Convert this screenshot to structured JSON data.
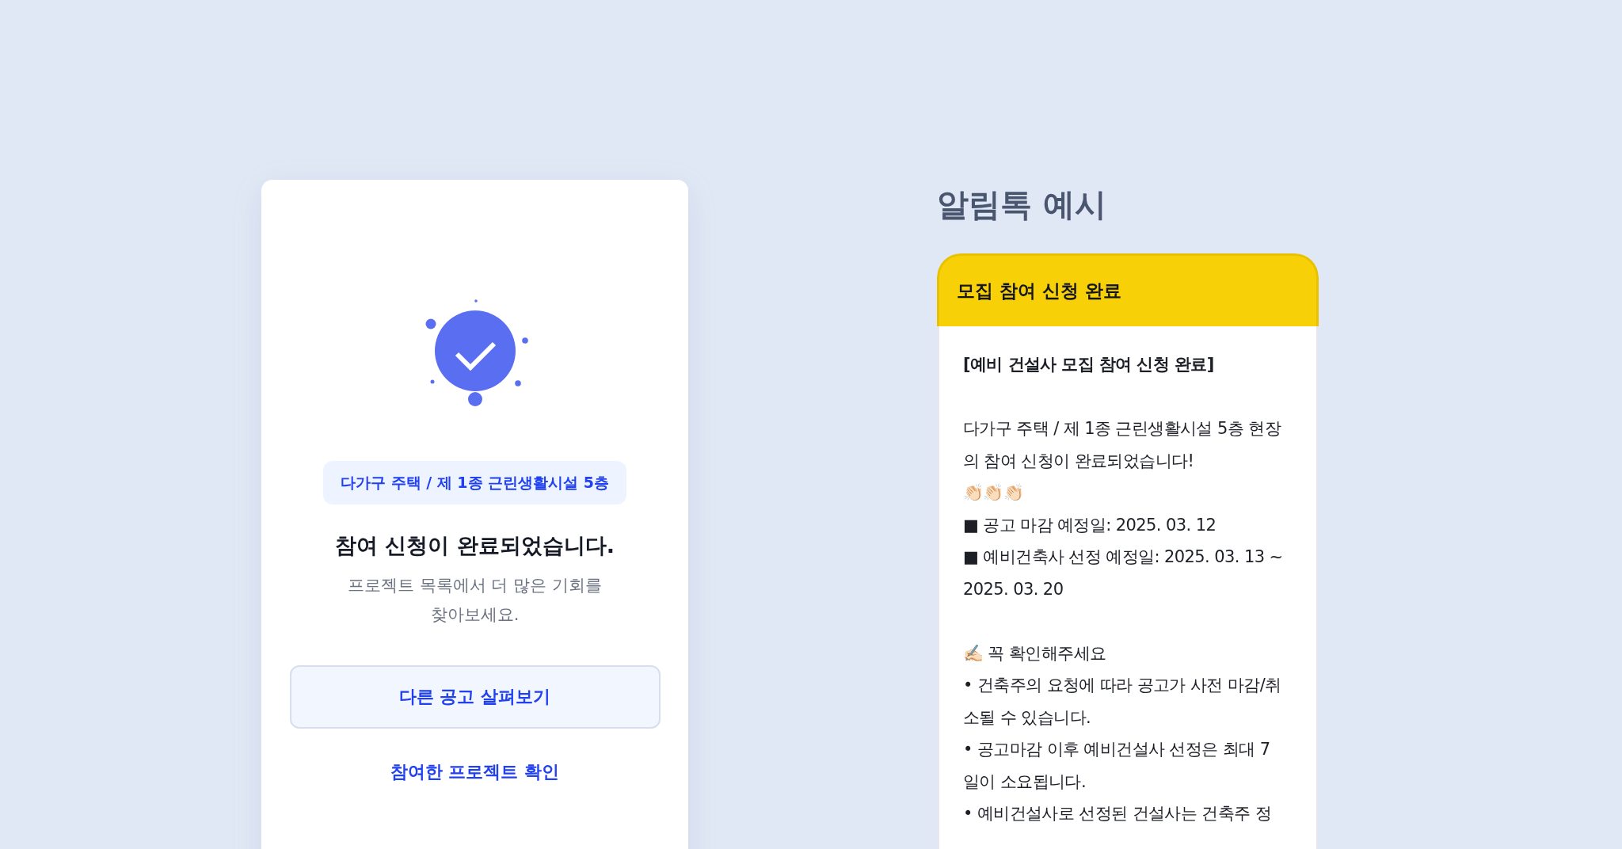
{
  "result_card": {
    "project_chip": "다가구 주택 / 제 1종 근린생활시설 5층",
    "title": "참여 신청이 완료되었습니다.",
    "subtitle": "프로젝트 목록에서 더 많은 기회를 찾아보세요.",
    "primary_button": "다른 공고 살펴보기",
    "link": "참여한 프로젝트 확인"
  },
  "alimtalk": {
    "heading": "알림톡 예시",
    "header": "모집 참여 신청 완료",
    "lines": [
      {
        "kind": "title",
        "text": "[예비 건설사 모집 참여 신청 완료]"
      },
      {
        "kind": "spaced",
        "text": "다가구 주택 / 제 1종 근린생활시설 5층 현장\n의 참여 신청이 완료되었습니다!"
      },
      {
        "kind": "text",
        "text": "👏🏻👏🏻👏🏻"
      },
      {
        "kind": "text",
        "text": "■ 공고 마감 예정일: 2025. 03. 12"
      },
      {
        "kind": "text",
        "text": "■ 예비건축사 선정 예정일: 2025. 03. 13 ~\n2025. 03. 20"
      },
      {
        "kind": "spaced",
        "text": "✍🏻 꼭 확인해주세요"
      },
      {
        "kind": "text",
        "text": "• 건축주의 요청에 따라 공고가 사전 마감/취\n소될 수 있습니다."
      },
      {
        "kind": "text",
        "text": "• 공고마감 이후 예비건설사 선정은 최대 7\n일이 소요됩니다."
      },
      {
        "kind": "text",
        "text": "• 예비건설사로 선정된 건설사는 건축주 정"
      }
    ]
  }
}
